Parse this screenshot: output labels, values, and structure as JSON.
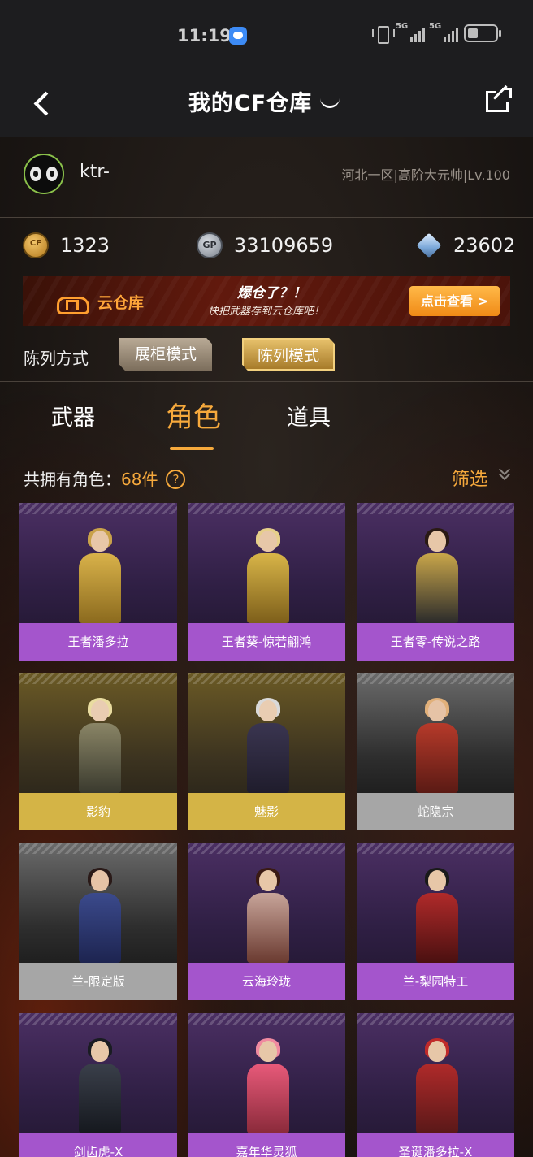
{
  "status_bar": {
    "time": "11:19",
    "network1": "5G",
    "network2": "5G"
  },
  "nav": {
    "title": "我的CF仓库"
  },
  "profile": {
    "username": "ktr-",
    "server": "河北一区|高阶大元帅|Lv.100"
  },
  "currencies": [
    {
      "icon": "cf-coin-icon",
      "value": "1323"
    },
    {
      "icon": "gp-coin-icon",
      "value": "33109659"
    },
    {
      "icon": "diamond-icon",
      "value": "23602"
    }
  ],
  "banner": {
    "title": "云仓库",
    "slogan_main": "爆仓了？！",
    "slogan_sub": "快把武器存到云仓库吧！",
    "button": "点击查看 >"
  },
  "display_mode": {
    "label": "陈列方式",
    "options": [
      "展柜模式",
      "陈列模式"
    ],
    "selected": "陈列模式"
  },
  "tabs": {
    "items": [
      "武器",
      "角色",
      "道具"
    ],
    "active": "角色"
  },
  "summary": {
    "prefix": "共拥有角色：",
    "count": "68件",
    "help": "?",
    "filter": "筛选"
  },
  "colors": {
    "accent": "#f6a93c",
    "purple_rarity": "#a455cc",
    "gold_rarity": "#d4b446",
    "silver_rarity": "#a6a6a6"
  },
  "characters": [
    {
      "name": "王者潘多拉",
      "rarity": "purple"
    },
    {
      "name": "王者葵-惊若翩鸿",
      "rarity": "purple"
    },
    {
      "name": "王者零-传说之路",
      "rarity": "purple"
    },
    {
      "name": "影豹",
      "rarity": "gold"
    },
    {
      "name": "魅影",
      "rarity": "gold"
    },
    {
      "name": "蛇隐宗",
      "rarity": "silver"
    },
    {
      "name": "兰-限定版",
      "rarity": "silver"
    },
    {
      "name": "云海玲珑",
      "rarity": "purple"
    },
    {
      "name": "兰-梨园特工",
      "rarity": "purple"
    },
    {
      "name": "剑齿虎-X",
      "rarity": "purple"
    },
    {
      "name": "嘉年华灵狐",
      "rarity": "purple"
    },
    {
      "name": "圣诞潘多拉-X",
      "rarity": "purple"
    }
  ]
}
